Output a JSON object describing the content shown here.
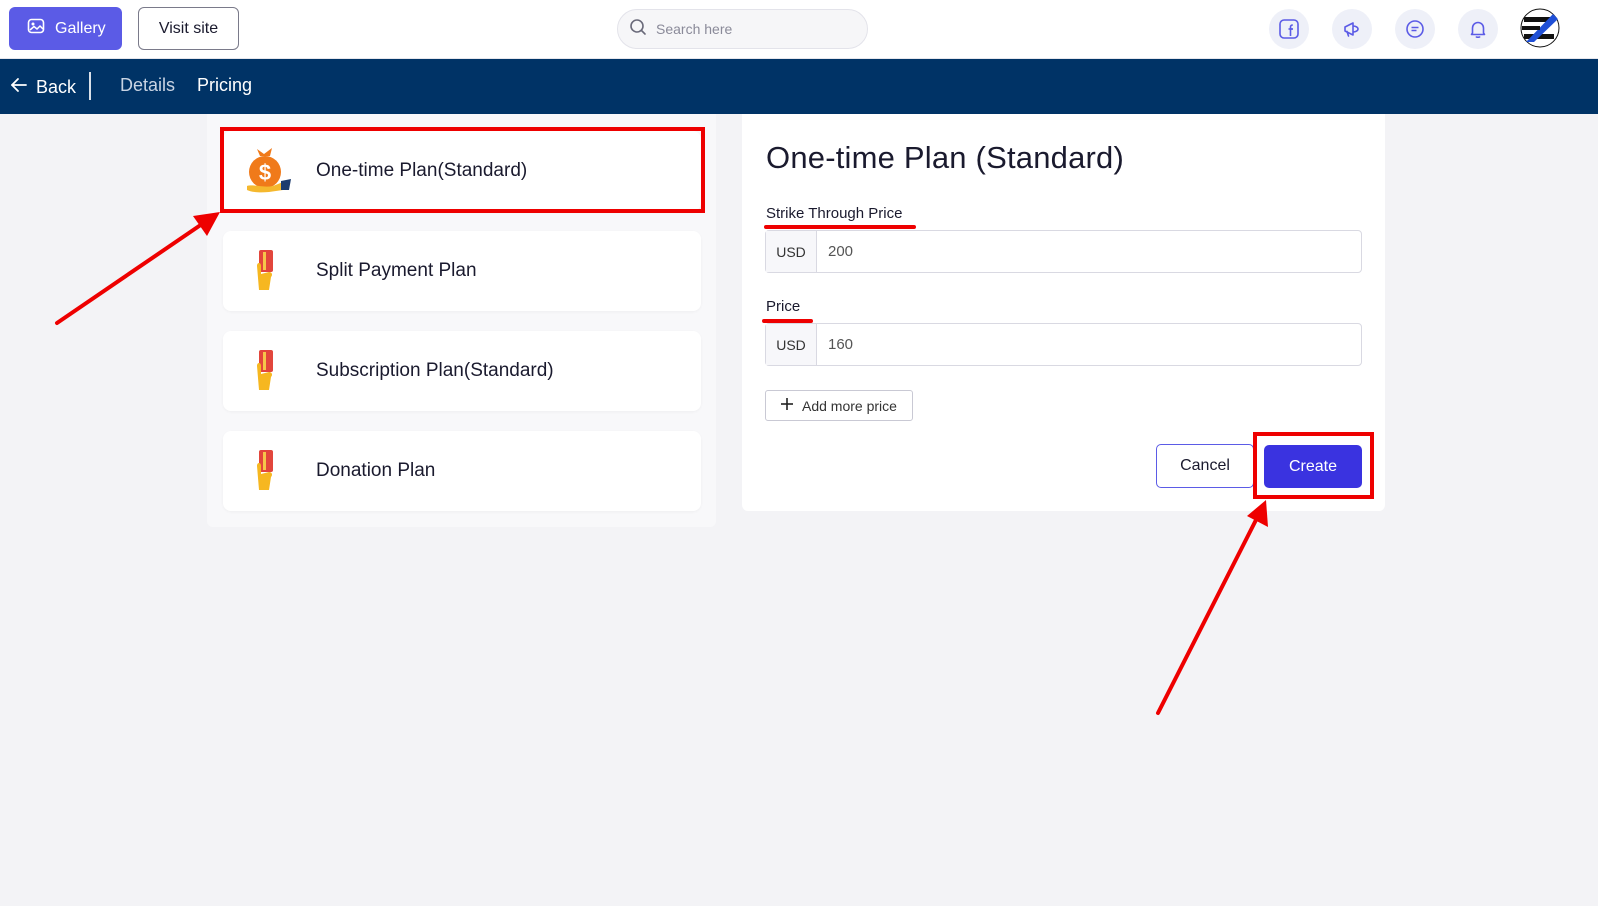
{
  "header": {
    "gallery_label": "Gallery",
    "visit_site_label": "Visit site",
    "search_placeholder": "Search here",
    "icons": [
      "facebook-icon",
      "megaphone-icon",
      "chat-icon",
      "bell-icon"
    ],
    "avatar_icon": "brand-logo-icon"
  },
  "nav": {
    "back_label": "Back",
    "tabs": [
      {
        "label": "Details",
        "active": false
      },
      {
        "label": "Pricing",
        "active": true
      }
    ]
  },
  "plans": [
    {
      "label": "One-time Plan(Standard)",
      "icon": "money-bag-icon",
      "selected": true
    },
    {
      "label": "Split Payment Plan",
      "icon": "card-in-hand-icon",
      "selected": false
    },
    {
      "label": "Subscription Plan(Standard)",
      "icon": "card-in-hand-icon",
      "selected": false
    },
    {
      "label": "Donation Plan",
      "icon": "card-in-hand-icon",
      "selected": false
    }
  ],
  "form": {
    "title": "One-time Plan (Standard)",
    "strike_label": "Strike Through Price",
    "strike_currency": "USD",
    "strike_value": "200",
    "price_label": "Price",
    "price_currency": "USD",
    "price_value": "160",
    "add_more_label": "Add more price",
    "cancel_label": "Cancel",
    "create_label": "Create"
  },
  "colors": {
    "accent": "#5b5be6",
    "create_button": "#3a33e0",
    "navbar": "#003366",
    "annotation": "#ee0000"
  }
}
